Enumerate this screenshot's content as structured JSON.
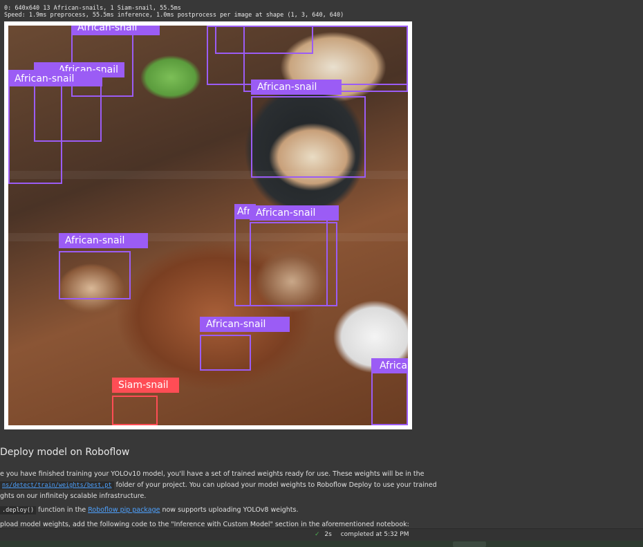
{
  "log": {
    "line1": "0: 640x640 13 African-snails, 1 Siam-snail, 55.5ms",
    "line2": "Speed: 1.9ms preprocess, 55.5ms inference, 1.0ms postprocess per image at shape (1, 3, 640, 640)"
  },
  "detections": {
    "d1": "African-snail",
    "d2": "African-snail",
    "d3": "African-snail",
    "d4": "African-snail",
    "d5": "African-snail",
    "d6": "Afr",
    "d7": "African-snail",
    "d8": "African-snail",
    "d9": "Siam-snail",
    "d10": "African-snail",
    "colors": {
      "african": "#9b5cf5",
      "siam": "#ff4d55"
    }
  },
  "markdown": {
    "title": "Deploy model on Roboflow",
    "p1_a": "e you have finished training your YOLOv10 model, you'll have a set of trained weights ready for use. These weights will be in the",
    "p2_code": "ns/detect/train/weights/best.pt",
    "p2_b": " folder of your project. You can upload your model weights to Roboflow Deploy to use your trained",
    "p3": "ghts on our infinitely scalable infrastructure.",
    "p4_code": ".deploy()",
    "p4_a": " function in the ",
    "p4_link": "Roboflow pip package",
    "p4_b": " now supports uploading YOLOv8 weights.",
    "p5": "pload model weights, add the following code to the \"Inference with Custom Model\" section in the aforementioned notebook:"
  },
  "status": {
    "duration": "2s",
    "completed": "completed at 5:32 PM"
  }
}
